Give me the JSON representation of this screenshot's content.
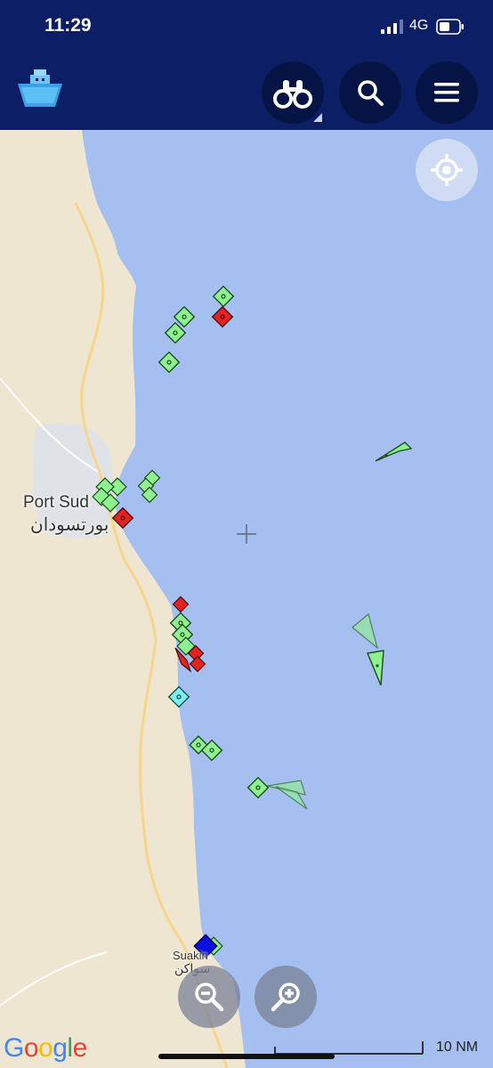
{
  "status": {
    "time": "11:29",
    "network": "4G"
  },
  "app": {
    "logo_icon": "ship-logo-icon"
  },
  "toolbar": {
    "binoculars_icon": "binoculars-icon",
    "search_icon": "search-icon",
    "menu_icon": "menu-icon"
  },
  "map": {
    "labels": {
      "port_sudan_en": "Port Sud",
      "port_sudan_ar": "بورتسودان",
      "suakin_en": "Suakin",
      "suakin_ar": "سواكن"
    },
    "scale_label": "10 NM",
    "google_letters": [
      "G",
      "o",
      "o",
      "g",
      "l",
      "e"
    ],
    "google_colors": [
      "#4285F4",
      "#EA4335",
      "#FBBC05",
      "#4285F4",
      "#34A853",
      "#EA4335"
    ],
    "colors": {
      "sea": "#a5bff0",
      "land": "#efe6d2",
      "vessel_green": "#8ff08f",
      "vessel_red": "#e42222",
      "vessel_cyan": "#7ff0f0",
      "vessel_blue": "#0a10e0"
    }
  }
}
